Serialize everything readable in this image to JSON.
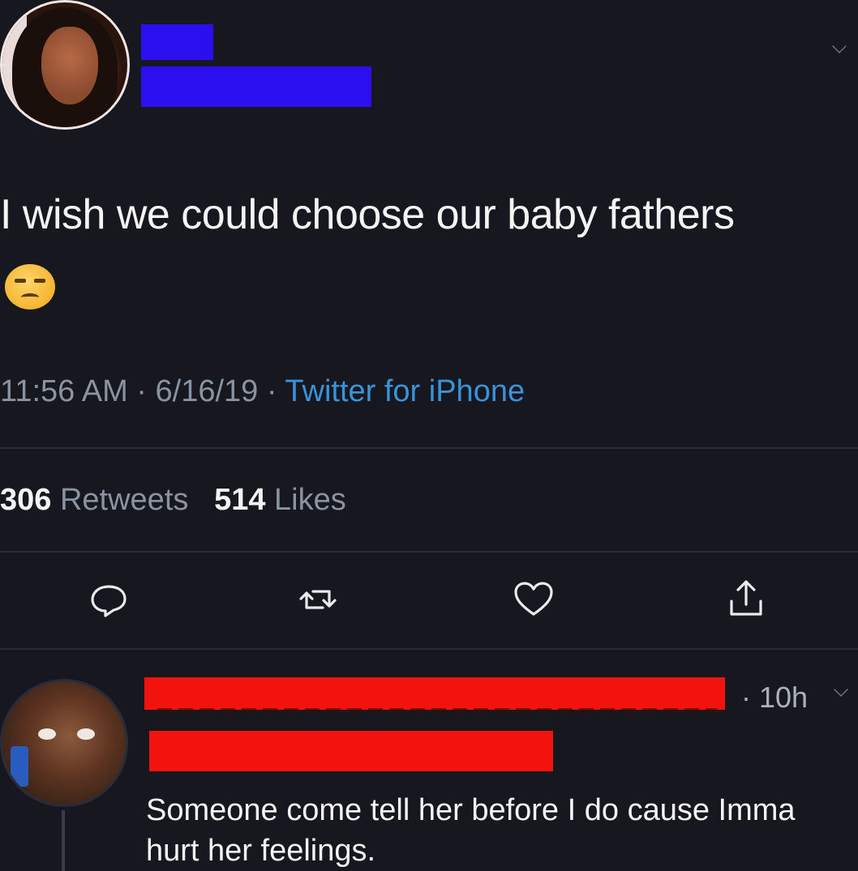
{
  "tweet": {
    "text": "I wish we could choose our baby fathers",
    "emoji": "unamused-face-emoji",
    "time": "11:56 AM",
    "separator": "·",
    "date": "6/16/19",
    "source": "Twitter for iPhone"
  },
  "stats": {
    "retweets_count": "306",
    "retweets_label": "Retweets",
    "likes_count": "514",
    "likes_label": "Likes"
  },
  "actions": [
    {
      "icon": "reply-icon"
    },
    {
      "icon": "retweet-icon"
    },
    {
      "icon": "like-heart-icon"
    },
    {
      "icon": "share-icon"
    }
  ],
  "reply": {
    "time": "· 10h",
    "text": "Someone come tell her before I do cause Imma hurt her feelings."
  },
  "colors": {
    "background": "#16171f",
    "source_link": "#3a92d8",
    "redaction_blue": "#2b0ff0",
    "redaction_red": "#f2130f",
    "muted_text": "#8a93a0"
  }
}
